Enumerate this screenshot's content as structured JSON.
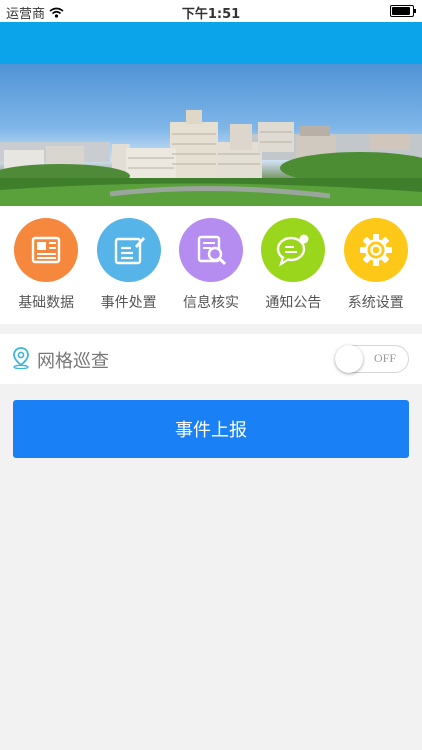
{
  "status_bar": {
    "carrier": "运营商",
    "time": "下午1:51"
  },
  "menu": [
    {
      "label": "基础数据",
      "icon": "newspaper-icon",
      "color": "#f5883c"
    },
    {
      "label": "事件处置",
      "icon": "edit-note-icon",
      "color": "#56b4e9"
    },
    {
      "label": "信息核实",
      "icon": "document-search-icon",
      "color": "#b58cf0"
    },
    {
      "label": "通知公告",
      "icon": "chat-bubble-icon",
      "color": "#9ad61b"
    },
    {
      "label": "系统设置",
      "icon": "gear-icon",
      "color": "#fdc818"
    }
  ],
  "patrol": {
    "label": "网格巡查",
    "toggle_state": "OFF"
  },
  "report_button": {
    "label": "事件上报"
  },
  "colors": {
    "nav_bar": "#0ba3e9",
    "primary_button": "#1a80f6"
  }
}
